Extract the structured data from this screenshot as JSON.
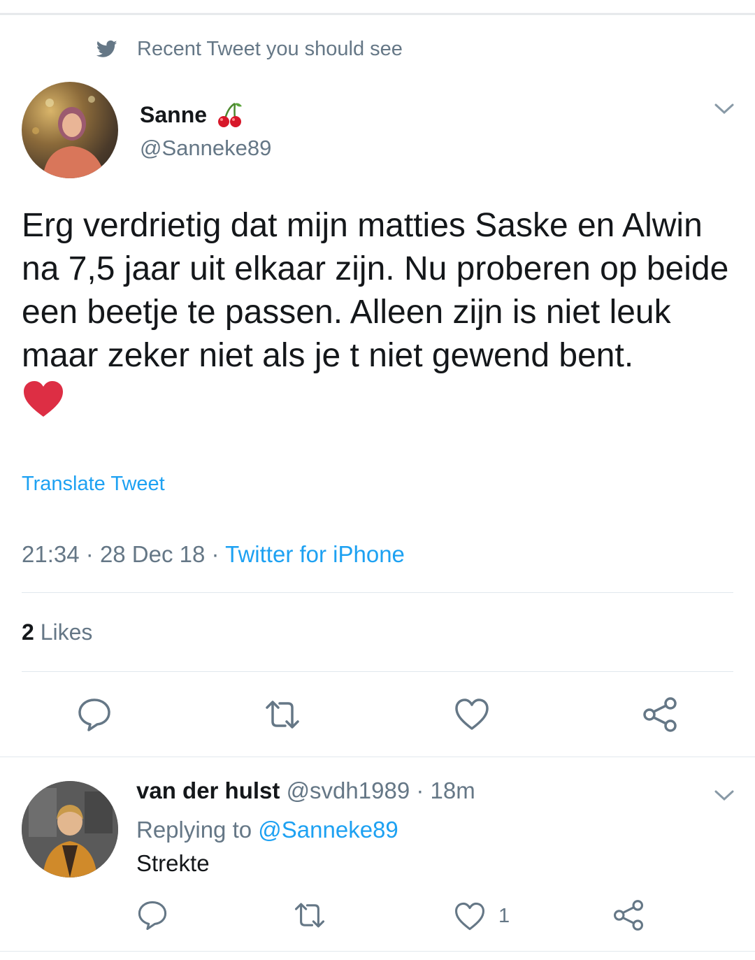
{
  "context": {
    "label": "Recent Tweet you should see"
  },
  "tweet": {
    "author_name": "Sanne",
    "author_handle": "@Sanneke89",
    "text": "Erg verdrietig dat mijn matties Saske en Alwin na 7,5 jaar uit elkaar zijn. Nu proberen op beide een beetje te passen. Alleen zijn is niet leuk maar zeker niet als je t niet gewend bent.",
    "translate_label": "Translate Tweet",
    "time": "21:34",
    "date": "28 Dec 18",
    "separator": "·",
    "source": "Twitter for iPhone",
    "likes_count": "2",
    "likes_label": "Likes"
  },
  "reply": {
    "author_name": "van der hulst",
    "author_handle": "@svdh1989",
    "age": "18m",
    "separator": "·",
    "replying_prefix": "Replying to",
    "replying_mention": "@Sanneke89",
    "text": "Strekte",
    "like_count": "1"
  },
  "icons": [
    "twitter-bird-icon",
    "cherry-icon",
    "chevron-down-icon",
    "red-heart-emoji",
    "reply-icon",
    "retweet-icon",
    "like-icon",
    "share-icon"
  ],
  "colors": {
    "accent": "#1da1f2",
    "secondary_text": "#657786",
    "primary_text": "#14171a",
    "divider": "#e1e8ed"
  }
}
